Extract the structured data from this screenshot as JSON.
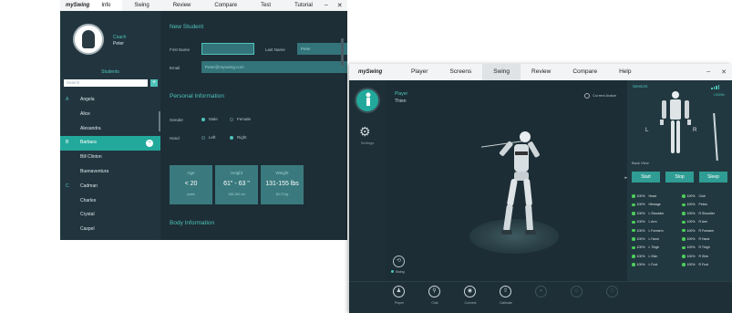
{
  "window1": {
    "logo": "mySwing",
    "tabs": [
      "Info",
      "Swing",
      "Review",
      "Compare",
      "Test",
      "Tutorial"
    ],
    "controls": {
      "minimize": "–",
      "close": "✕"
    },
    "coach": {
      "role": "Coach",
      "name": "Peter"
    },
    "students_heading": "Students",
    "search": {
      "placeholder": "Search"
    },
    "add_icon": "+",
    "students": [
      {
        "letter": "A",
        "name": "Angela"
      },
      {
        "letter": "",
        "name": "Alice"
      },
      {
        "letter": "",
        "name": "Alexandra"
      },
      {
        "letter": "B",
        "name": "Barbara",
        "selected": true
      },
      {
        "letter": "",
        "name": "Bill Clinton"
      },
      {
        "letter": "",
        "name": "Buenaventura"
      },
      {
        "letter": "C",
        "name": "Cadman"
      },
      {
        "letter": "",
        "name": "Charles"
      },
      {
        "letter": "",
        "name": "Crystal"
      },
      {
        "letter": "",
        "name": "Caspel"
      }
    ],
    "new_student": {
      "title": "New Student",
      "first_name_label": "First Name",
      "last_name_label": "Last Name",
      "last_name_value": "Peter",
      "email_label": "Email",
      "email_value": "Peter@myswing.com"
    },
    "personal_info": {
      "title": "Personal Information",
      "gender_label": "Gender",
      "gender_options": [
        "Male",
        "Female"
      ],
      "gender_selected": "Male",
      "hand_label": "Hand",
      "hand_options": [
        "Left",
        "Right"
      ],
      "hand_selected": "Right",
      "cards": [
        {
          "title": "Age",
          "value": "< 20",
          "unit": "years"
        },
        {
          "title": "Height",
          "value": "61\" - 63 \"",
          "unit": "155-160 cm"
        },
        {
          "title": "Weight",
          "value": "131-155 lbs",
          "unit": "60-70 kg"
        }
      ]
    },
    "body_info": {
      "title": "Body Information"
    }
  },
  "window2": {
    "logo": "mySwing",
    "tabs": [
      "Player",
      "Screens",
      "Swing",
      "Review",
      "Compare",
      "Help"
    ],
    "active_tab": "Swing",
    "controls": {
      "minimize": "–",
      "close": "✕"
    },
    "settings_label": "Settings",
    "viewport": {
      "player_label": "Player",
      "player_name": "Thien",
      "camera_label": "Current Avatar"
    },
    "cycle_label": "Swing",
    "sensors_label": "Sensors",
    "sensor_mode": "1000Hz",
    "lr": {
      "left": "L",
      "right": "R"
    },
    "back_view_label": "Back View",
    "buttons": {
      "start": "Start",
      "stop": "Stop",
      "sleep": "Sleep"
    },
    "sensors": [
      {
        "left": {
          "pct": "100%",
          "name": "Head"
        },
        "right": {
          "pct": "100%",
          "name": "Club"
        }
      },
      {
        "left": {
          "pct": "100%",
          "name": "Hbmage"
        },
        "right": {
          "pct": "100%",
          "name": "Pelvis"
        }
      },
      {
        "left": {
          "pct": "100%",
          "name": "L Shoulder"
        },
        "right": {
          "pct": "100%",
          "name": "R Shoulder"
        }
      },
      {
        "left": {
          "pct": "100%",
          "name": "L Arm"
        },
        "right": {
          "pct": "100%",
          "name": "R Arm"
        }
      },
      {
        "left": {
          "pct": "100%",
          "name": "L Forearm"
        },
        "right": {
          "pct": "100%",
          "name": "R Forearm"
        }
      },
      {
        "left": {
          "pct": "100%",
          "name": "L Hand"
        },
        "right": {
          "pct": "100%",
          "name": "R Hand"
        }
      },
      {
        "left": {
          "pct": "100%",
          "name": "L Thigh"
        },
        "right": {
          "pct": "100%",
          "name": "R Thigh"
        }
      },
      {
        "left": {
          "pct": "100%",
          "name": "L Shin"
        },
        "right": {
          "pct": "100%",
          "name": "R Shin"
        }
      },
      {
        "left": {
          "pct": "100%",
          "name": "L Foot"
        },
        "right": {
          "pct": "100%",
          "name": "R Foot"
        }
      }
    ],
    "bottom_tools": [
      {
        "icon": "player-icon",
        "label": "Player"
      },
      {
        "icon": "club-icon",
        "label": "Club"
      },
      {
        "icon": "connect-icon",
        "label": "Connect"
      },
      {
        "icon": "calibrate-icon",
        "label": "Calibrate"
      },
      {
        "icon": "record-icon",
        "label": ""
      },
      {
        "icon": "playback-icon",
        "label": ""
      },
      {
        "icon": "export-icon",
        "label": ""
      }
    ]
  },
  "colors": {
    "accent": "#22a99b",
    "panel": "#1d2e37",
    "sensor_ok": "#4ccf5a"
  }
}
